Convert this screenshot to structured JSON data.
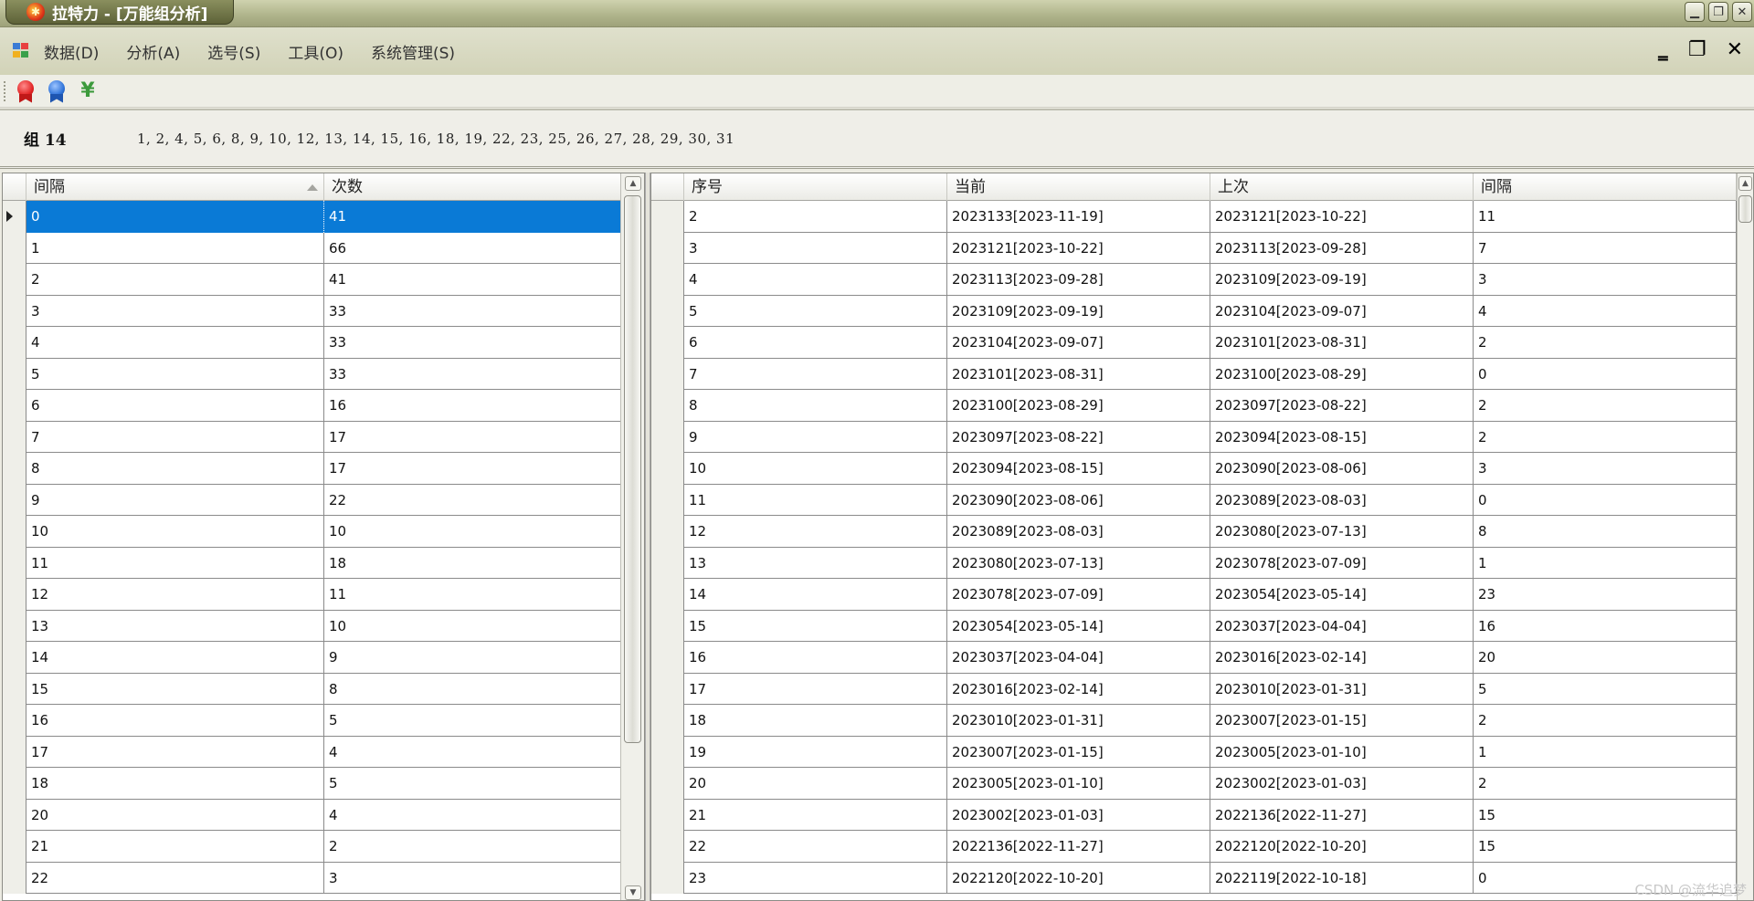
{
  "window": {
    "title": "拉特力 - [万能组分析]",
    "icon": "app-logo-icon",
    "controls": [
      "minimize-icon",
      "restore-icon",
      "close-icon"
    ]
  },
  "menu": {
    "items": [
      "数据(D)",
      "分析(A)",
      "选号(S)",
      "工具(O)",
      "系统管理(S)"
    ],
    "mdi_controls": [
      "minimize-icon",
      "restore-icon",
      "close-icon"
    ]
  },
  "toolbar": {
    "buttons": [
      "red-ribbon-medal-icon",
      "blue-ribbon-medal-icon",
      "yen-icon"
    ],
    "yen_glyph": "¥",
    "colors": {
      "red": "#e02020",
      "blue": "#2a6fd6",
      "green": "#3c9a3c"
    }
  },
  "group": {
    "label": "组 14",
    "numbers": "1, 2, 4, 5, 6, 8, 9, 10, 12, 13, 14, 15, 16, 18, 19, 22, 23, 25, 26, 27, 28, 29, 30, 31"
  },
  "left_grid": {
    "columns": [
      "间隔",
      "次数"
    ],
    "sorted_column": "间隔",
    "selected_row": 0,
    "rows": [
      [
        "0",
        "41"
      ],
      [
        "1",
        "66"
      ],
      [
        "2",
        "41"
      ],
      [
        "3",
        "33"
      ],
      [
        "4",
        "33"
      ],
      [
        "5",
        "33"
      ],
      [
        "6",
        "16"
      ],
      [
        "7",
        "17"
      ],
      [
        "8",
        "17"
      ],
      [
        "9",
        "22"
      ],
      [
        "10",
        "10"
      ],
      [
        "11",
        "18"
      ],
      [
        "12",
        "11"
      ],
      [
        "13",
        "10"
      ],
      [
        "14",
        "9"
      ],
      [
        "15",
        "8"
      ],
      [
        "16",
        "5"
      ],
      [
        "17",
        "4"
      ],
      [
        "18",
        "5"
      ],
      [
        "20",
        "4"
      ],
      [
        "21",
        "2"
      ],
      [
        "22",
        "3"
      ]
    ]
  },
  "right_grid": {
    "columns": [
      "序号",
      "当前",
      "上次",
      "间隔"
    ],
    "rows": [
      [
        "2",
        "2023133[2023-11-19]",
        "2023121[2023-10-22]",
        "11"
      ],
      [
        "3",
        "2023121[2023-10-22]",
        "2023113[2023-09-28]",
        "7"
      ],
      [
        "4",
        "2023113[2023-09-28]",
        "2023109[2023-09-19]",
        "3"
      ],
      [
        "5",
        "2023109[2023-09-19]",
        "2023104[2023-09-07]",
        "4"
      ],
      [
        "6",
        "2023104[2023-09-07]",
        "2023101[2023-08-31]",
        "2"
      ],
      [
        "7",
        "2023101[2023-08-31]",
        "2023100[2023-08-29]",
        "0"
      ],
      [
        "8",
        "2023100[2023-08-29]",
        "2023097[2023-08-22]",
        "2"
      ],
      [
        "9",
        "2023097[2023-08-22]",
        "2023094[2023-08-15]",
        "2"
      ],
      [
        "10",
        "2023094[2023-08-15]",
        "2023090[2023-08-06]",
        "3"
      ],
      [
        "11",
        "2023090[2023-08-06]",
        "2023089[2023-08-03]",
        "0"
      ],
      [
        "12",
        "2023089[2023-08-03]",
        "2023080[2023-07-13]",
        "8"
      ],
      [
        "13",
        "2023080[2023-07-13]",
        "2023078[2023-07-09]",
        "1"
      ],
      [
        "14",
        "2023078[2023-07-09]",
        "2023054[2023-05-14]",
        "23"
      ],
      [
        "15",
        "2023054[2023-05-14]",
        "2023037[2023-04-04]",
        "16"
      ],
      [
        "16",
        "2023037[2023-04-04]",
        "2023016[2023-02-14]",
        "20"
      ],
      [
        "17",
        "2023016[2023-02-14]",
        "2023010[2023-01-31]",
        "5"
      ],
      [
        "18",
        "2023010[2023-01-31]",
        "2023007[2023-01-15]",
        "2"
      ],
      [
        "19",
        "2023007[2023-01-15]",
        "2023005[2023-01-10]",
        "1"
      ],
      [
        "20",
        "2023005[2023-01-10]",
        "2023002[2023-01-03]",
        "2"
      ],
      [
        "21",
        "2023002[2023-01-03]",
        "2022136[2022-11-27]",
        "15"
      ],
      [
        "22",
        "2022136[2022-11-27]",
        "2022120[2022-10-20]",
        "15"
      ],
      [
        "23",
        "2022120[2022-10-20]",
        "2022119[2022-10-18]",
        "0"
      ]
    ]
  },
  "watermark": "CSDN @流华追梦"
}
